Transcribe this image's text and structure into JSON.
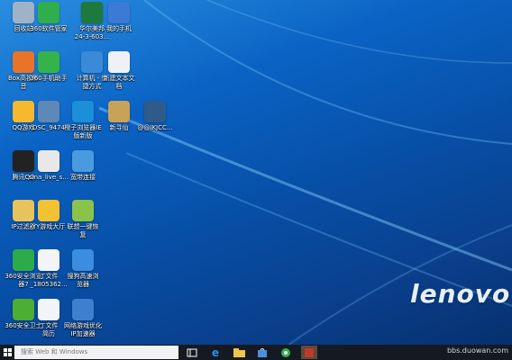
{
  "desktop": {
    "brand": "lenovo",
    "icons": [
      {
        "id": "recycle",
        "label": "回收站",
        "icon": "recycle-bin-icon",
        "color": "#9fb3c8"
      },
      {
        "id": "360mgr",
        "label": "360软件管家",
        "icon": "360-software-manager-icon",
        "color": "#2fae4e"
      },
      {
        "id": "excel",
        "label": "华尔美邦\n24-3-603...",
        "icon": "excel-file-icon",
        "color": "#1e7a3c"
      },
      {
        "id": "myphone",
        "label": "我的手机",
        "icon": "phone-icon",
        "color": "#3a7bd5"
      },
      {
        "id": "pptv",
        "label": "Box高视影\n音",
        "icon": "video-player-icon",
        "color": "#e8742a"
      },
      {
        "id": "360phone",
        "label": "360手机助手",
        "icon": "360-phone-assistant-icon",
        "color": "#35b24a"
      },
      {
        "id": "computer",
        "label": "计算机 - 快\n捷方式",
        "icon": "computer-icon",
        "color": "#3a8ad8"
      },
      {
        "id": "newtxt",
        "label": "新建文本文\n档",
        "icon": "text-document-icon",
        "color": "#eef2f7"
      },
      {
        "id": "qqgame",
        "label": "QQ游戏",
        "icon": "qq-game-icon",
        "color": "#f5b82e"
      },
      {
        "id": "photo",
        "label": "DSC_9474",
        "icon": "photo-icon",
        "color": "#5d88b8"
      },
      {
        "id": "ie",
        "label": "橙子浏览器IE\n版新版",
        "icon": "browser-icon",
        "color": "#1b8fd8"
      },
      {
        "id": "xinzhuxian",
        "label": "新寻仙",
        "icon": "game-icon",
        "color": "#c9a25a"
      },
      {
        "id": "cc",
        "label": "@@IKJCC...",
        "icon": "game-shortcut-icon",
        "color": "#2f5b8a"
      },
      {
        "id": "qq",
        "label": "腾讯QQ",
        "icon": "qq-icon",
        "color": "#222222"
      },
      {
        "id": "sina",
        "label": "sina_live_s...",
        "icon": "sina-live-icon",
        "color": "#e8e8e8"
      },
      {
        "id": "broadband",
        "label": "宽带连接",
        "icon": "network-connection-icon",
        "color": "#4a9ae0"
      },
      {
        "id": "ipfilter",
        "label": "IP过滤器",
        "icon": "folder-icon",
        "color": "#e6c35c"
      },
      {
        "id": "yygame",
        "label": "YY游戏大厅",
        "icon": "yy-game-icon",
        "color": "#f2c232"
      },
      {
        "id": "lenovorecovery",
        "label": "联想一键恢\n复",
        "icon": "lenovo-recovery-icon",
        "color": "#8bc34a"
      },
      {
        "id": "360browser",
        "label": "360安全浏览\n器7",
        "icon": "360-browser-icon",
        "color": "#2dab4c"
      },
      {
        "id": "dingfile",
        "label": "丁文件\n_1805362...",
        "icon": "document-file-icon",
        "color": "#f2f4f7"
      },
      {
        "id": "sogou",
        "label": "搜狗高速浏\n览器",
        "icon": "sogou-browser-icon",
        "color": "#3a8de0"
      },
      {
        "id": "360guard",
        "label": "360安全卫士",
        "icon": "360-security-icon",
        "color": "#4cae33"
      },
      {
        "id": "dingfile2",
        "label": "丁文件\n简历",
        "icon": "document-file-icon",
        "color": "#f2f4f7"
      },
      {
        "id": "netbar",
        "label": "网络游戏优化\nIP加速器",
        "icon": "network-accelerator-icon",
        "color": "#3f7fd0"
      }
    ]
  },
  "taskbar": {
    "search_placeholder": "搜索 Web 和 Windows",
    "watermark": "bbs.duowan.com",
    "buttons": [
      {
        "id": "taskview",
        "icon": "task-view-icon"
      },
      {
        "id": "edge",
        "icon": "edge-browser-icon"
      },
      {
        "id": "explorer",
        "icon": "file-explorer-icon"
      },
      {
        "id": "store",
        "icon": "store-icon"
      },
      {
        "id": "360",
        "icon": "360-browser-icon"
      },
      {
        "id": "app",
        "icon": "app-icon"
      }
    ]
  }
}
